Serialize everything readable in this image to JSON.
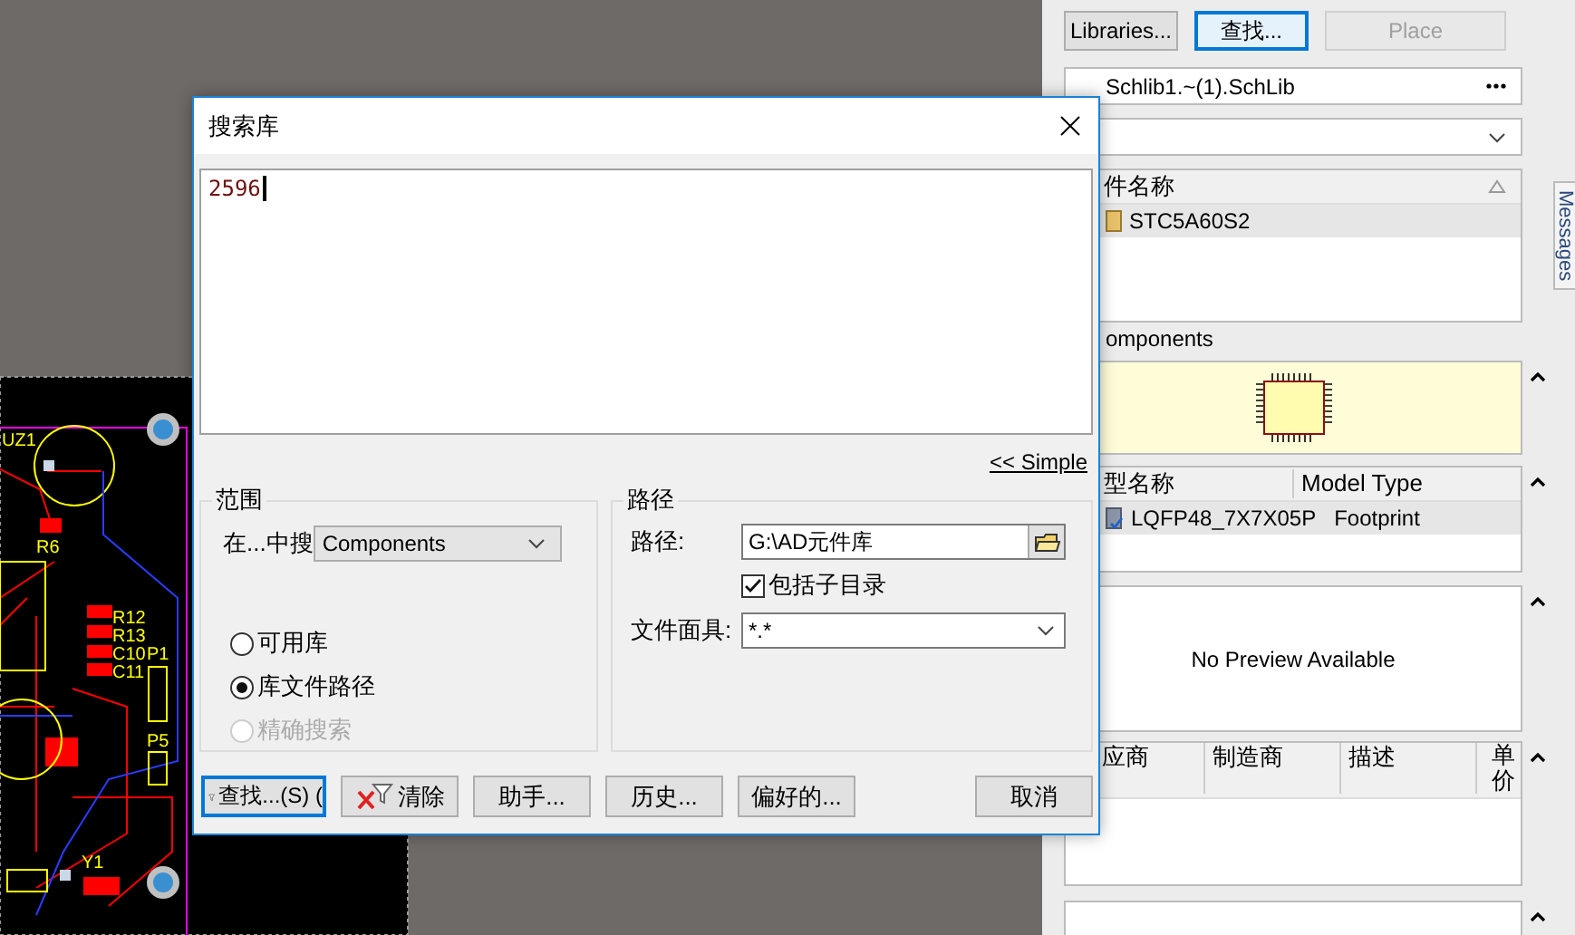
{
  "pcb": {
    "labels": [
      "UZ1",
      "R6",
      "R12",
      "R13",
      "C10",
      "C11",
      "P1",
      "P5",
      "Y1"
    ]
  },
  "dialog": {
    "title": "搜索库",
    "query": "2596",
    "simple_link": "<< Simple",
    "scope": {
      "title": "范围",
      "search_in_label": "在...中搜",
      "search_in": "Components",
      "options": [
        {
          "label": "可用库",
          "selected": false,
          "disabled": false
        },
        {
          "label": "库文件路径",
          "selected": true,
          "disabled": false
        },
        {
          "label": "精确搜索",
          "selected": false,
          "disabled": true
        }
      ]
    },
    "path": {
      "title": "路径",
      "path_label": "路径:",
      "path": "G:\\AD元件库",
      "include_subdirs": {
        "label": "包括子目录",
        "checked": true
      },
      "mask_label": "文件面具:",
      "mask": "*.*"
    },
    "buttons": [
      {
        "label": "查找...(S) (",
        "kind": "search",
        "focused": true
      },
      {
        "label": "清除",
        "kind": "clear",
        "focused": false
      },
      {
        "label": "助手...",
        "kind": "plain",
        "focused": false
      },
      {
        "label": "历史...",
        "kind": "plain",
        "focused": false
      },
      {
        "label": "偏好的...",
        "kind": "plain",
        "focused": false
      },
      {
        "label": "取消",
        "kind": "cancel",
        "focused": false
      }
    ]
  },
  "panel": {
    "buttons": [
      {
        "label": "Libraries...",
        "focused": false,
        "disabled": false
      },
      {
        "label": "查找...",
        "focused": true,
        "disabled": false
      },
      {
        "label": "Place",
        "focused": false,
        "disabled": true
      }
    ],
    "library": "Schlib1.~(1).SchLib",
    "components": {
      "columns": [
        "件名称"
      ],
      "rows": [
        {
          "name": "STC5A60S2",
          "selected": true
        }
      ]
    },
    "components_label": "omponents",
    "models": {
      "columns": [
        "型名称",
        "Model Type"
      ],
      "rows": [
        {
          "name": "LQFP48_7X7X05P",
          "type": "Footprint",
          "selected": true
        }
      ]
    },
    "model_preview": "No Preview Available",
    "suppliers": {
      "columns": [
        "应商",
        "制造商",
        "描述",
        "单价"
      ]
    },
    "side_tabs": [
      "Messages"
    ]
  }
}
